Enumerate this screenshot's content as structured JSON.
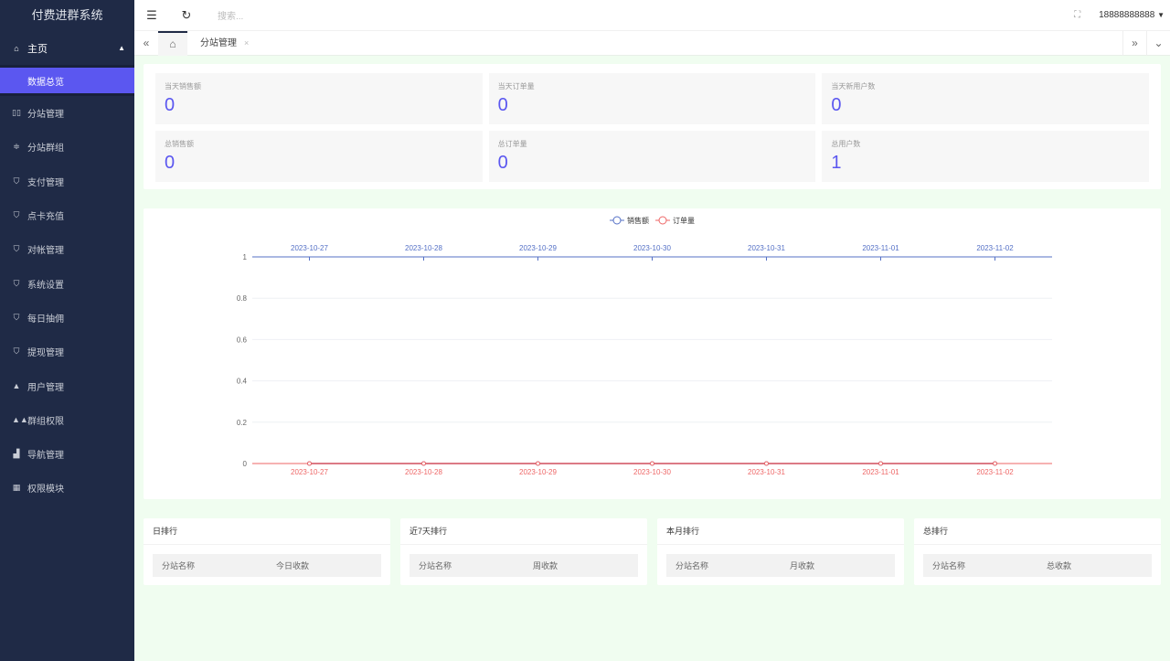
{
  "app": {
    "title": "付费进群系统"
  },
  "sidebar": {
    "parent": {
      "label": "主页",
      "icon": "home-icon"
    },
    "active": {
      "label": "数据总览"
    },
    "items": [
      {
        "label": "分站管理",
        "icon": "columns-icon"
      },
      {
        "label": "分站群组",
        "icon": "sliders-icon"
      },
      {
        "label": "支付管理",
        "icon": "shield-check-icon"
      },
      {
        "label": "点卡充值",
        "icon": "shield-check-icon"
      },
      {
        "label": "对帐管理",
        "icon": "shield-check-icon"
      },
      {
        "label": "系统设置",
        "icon": "shield-check-icon"
      },
      {
        "label": "每日抽佣",
        "icon": "shield-check-icon"
      },
      {
        "label": "提现管理",
        "icon": "shield-check-icon"
      },
      {
        "label": "用户管理",
        "icon": "user-icon"
      },
      {
        "label": "群组权限",
        "icon": "users-icon"
      },
      {
        "label": "导航管理",
        "icon": "chart-icon"
      },
      {
        "label": "权限模块",
        "icon": "grid-icon"
      }
    ]
  },
  "header": {
    "search_placeholder": "搜索...",
    "user": "18888888888"
  },
  "tabs": [
    {
      "label": "分站管理"
    }
  ],
  "stats": [
    {
      "label": "当天销售额",
      "value": "0"
    },
    {
      "label": "当天订单量",
      "value": "0"
    },
    {
      "label": "当天新用户数",
      "value": "0"
    },
    {
      "label": "总销售额",
      "value": "0"
    },
    {
      "label": "总订单量",
      "value": "0"
    },
    {
      "label": "总用户数",
      "value": "1"
    }
  ],
  "chart_data": {
    "type": "line",
    "categories": [
      "2023-10-27",
      "2023-10-28",
      "2023-10-29",
      "2023-10-30",
      "2023-10-31",
      "2023-11-01",
      "2023-11-02"
    ],
    "series": [
      {
        "name": "销售额",
        "values": [
          0,
          0,
          0,
          0,
          0,
          0,
          0
        ],
        "color": "#5470c6",
        "axis": "top"
      },
      {
        "name": "订单量",
        "values": [
          0,
          0,
          0,
          0,
          0,
          0,
          0
        ],
        "color": "#ee6666",
        "axis": "bottom"
      }
    ],
    "ylim": [
      0,
      1
    ],
    "yticks": [
      "0",
      "0.2",
      "0.4",
      "0.6",
      "0.8",
      "1"
    ],
    "legend": "top-center",
    "grid": true
  },
  "rankings": [
    {
      "title": "日排行",
      "col1": "分站名称",
      "col2": "今日收款"
    },
    {
      "title": "近7天排行",
      "col1": "分站名称",
      "col2": "周收款"
    },
    {
      "title": "本月排行",
      "col1": "分站名称",
      "col2": "月收款"
    },
    {
      "title": "总排行",
      "col1": "分站名称",
      "col2": "总收款"
    }
  ]
}
